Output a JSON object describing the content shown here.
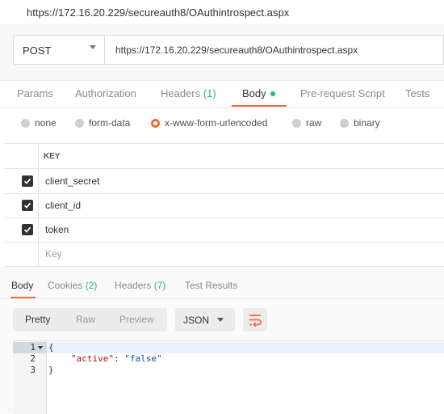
{
  "window": {
    "title": "https://172.16.20.229/secureauth8/OAuthintrospect.aspx"
  },
  "request": {
    "method": "POST",
    "url": "https://172.16.20.229/secureauth8/OAuthintrospect.aspx"
  },
  "request_tabs": {
    "params": "Params",
    "authorization": "Authorization",
    "headers": "Headers",
    "headers_count": "(1)",
    "body": "Body",
    "prerequest": "Pre-request Script",
    "tests": "Tests"
  },
  "body_modes": [
    {
      "label": "none"
    },
    {
      "label": "form-data"
    },
    {
      "label": "x-www-form-urlencoded"
    },
    {
      "label": "raw"
    },
    {
      "label": "binary"
    }
  ],
  "selected_body_mode": "x-www-form-urlencoded",
  "kv_table": {
    "key_header": "KEY",
    "rows": [
      {
        "key": "client_secret",
        "checked": true
      },
      {
        "key": "client_id",
        "checked": true
      },
      {
        "key": "token",
        "checked": true
      }
    ],
    "new_key_placeholder": "Key"
  },
  "response_tabs": {
    "body": "Body",
    "cookies": "Cookies",
    "cookies_count": "(2)",
    "headers": "Headers",
    "headers_count": "(7)",
    "test_results": "Test Results"
  },
  "view_modes": {
    "pretty": "Pretty",
    "raw": "Raw",
    "preview": "Preview"
  },
  "format": "JSON",
  "response_body": {
    "line_numbers": [
      "1",
      "2",
      "3"
    ],
    "open_brace": "{",
    "key": "\"active\"",
    "colon": ": ",
    "value": "\"false\"",
    "close_brace": "}"
  },
  "colors": {
    "accent": "#f26b3a",
    "count": "#26b47f"
  }
}
